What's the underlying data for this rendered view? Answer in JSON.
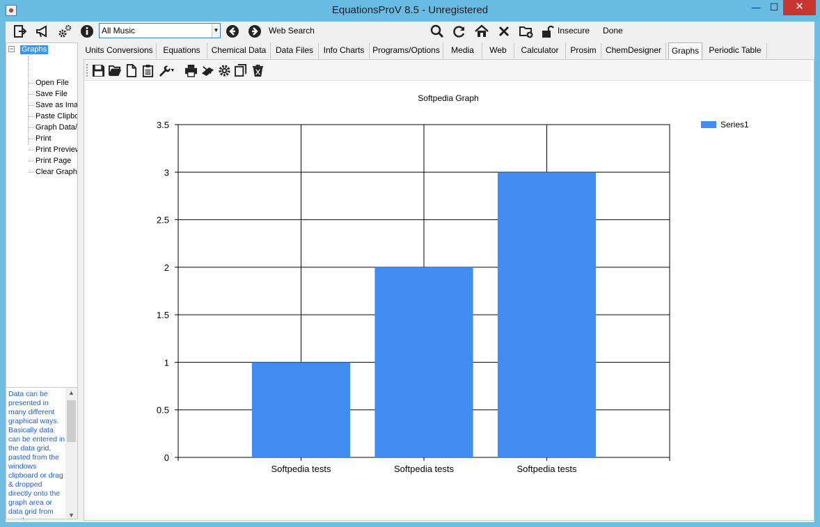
{
  "window": {
    "title": "EquationsProV 8.5 - Unregistered",
    "controls": {
      "minimize": "—",
      "maximize": "☐",
      "close": "✕"
    }
  },
  "toolbar": {
    "combo_value": "All Music",
    "web_search_label": "Web Search",
    "insecure_label": "Insecure",
    "status_label": "Done"
  },
  "tree": {
    "root": "Graphs",
    "toggle": "−",
    "items": [
      "Open File",
      "Save File",
      "Save as Image",
      "Paste Clipboard",
      "Graph Data/Settings",
      "Print",
      "Print Preview",
      "Print Page",
      "Clear Graph"
    ]
  },
  "help": {
    "text": "Data can be presented in many different graphical ways. Basically data can be entered in the data grid, pasted from the windows clipboard or drag & dropped directly onto the graph area or data grid from another"
  },
  "tabs": [
    "Units Conversions",
    "Equations",
    "Chemical Data",
    "Data Files",
    "Info Charts",
    "Programs/Options",
    "Media",
    "Web",
    "Calculator",
    "Prosim",
    "ChemDesigner",
    "Graphs",
    "Periodic Table"
  ],
  "active_tab": "Graphs",
  "chart_data": {
    "type": "bar",
    "title": "Softpedia Graph",
    "categories": [
      "Softpedia tests",
      "Softpedia tests",
      "Softpedia tests"
    ],
    "series": [
      {
        "name": "Series1",
        "values": [
          1,
          2,
          3
        ],
        "color": "#418cf0"
      }
    ],
    "ylim": [
      0,
      3.5
    ],
    "yticks": [
      "0",
      "0.5",
      "1",
      "1.5",
      "2",
      "2.5",
      "3",
      "3.5"
    ],
    "xlabel": "",
    "ylabel": "",
    "grid": true,
    "legend": "top-right"
  }
}
